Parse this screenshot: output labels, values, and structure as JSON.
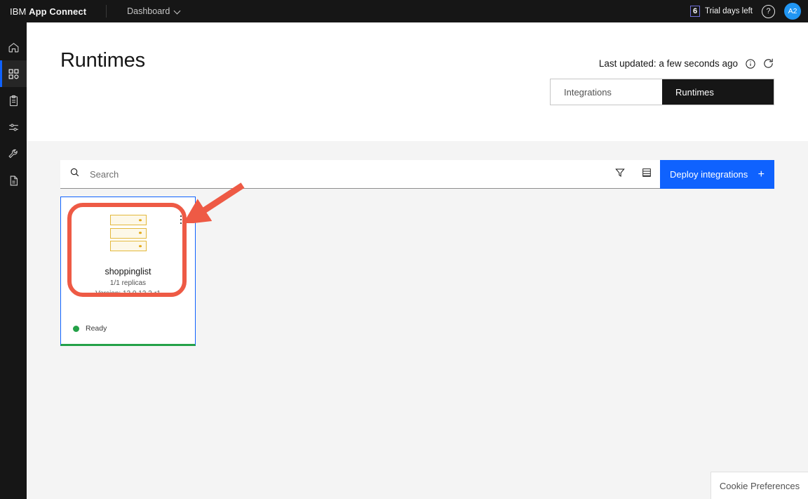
{
  "topbar": {
    "brand_prefix": "IBM",
    "brand_name": "App Connect",
    "nav_label": "Dashboard",
    "trial_days": "6",
    "trial_text": "Trial days left",
    "help_glyph": "?",
    "avatar_initials": "A2"
  },
  "sidebar": {
    "items": [
      {
        "name": "home",
        "label": "Home"
      },
      {
        "name": "dashboard",
        "label": "Dashboard"
      },
      {
        "name": "catalog",
        "label": "Catalog"
      },
      {
        "name": "settings",
        "label": "Settings"
      },
      {
        "name": "tools",
        "label": "Tools"
      },
      {
        "name": "docs",
        "label": "Documentation"
      }
    ]
  },
  "header": {
    "title": "Runtimes",
    "last_updated": "Last updated: a few seconds ago",
    "tabs": [
      {
        "label": "Integrations",
        "active": false
      },
      {
        "label": "Runtimes",
        "active": true
      }
    ]
  },
  "toolbar": {
    "search_placeholder": "Search",
    "search_value": "",
    "filter_label": "Filter",
    "list_view_label": "List view",
    "deploy_label": "Deploy integrations",
    "deploy_plus": "+"
  },
  "runtime_card": {
    "name": "shoppinglist",
    "replicas": "1/1 replicas",
    "version": "Version: 12.0.12.2-r1",
    "status": "Ready",
    "status_color": "#24a148",
    "menu_label": "More options"
  },
  "cookie": {
    "label": "Cookie Preferences"
  },
  "colors": {
    "accent_blue": "#0f62fe",
    "header_dark": "#161616",
    "content_bg": "#f4f4f4",
    "status_green": "#24a148",
    "annotation_red": "#ee5a45",
    "server_gold": "#e3b83c"
  }
}
